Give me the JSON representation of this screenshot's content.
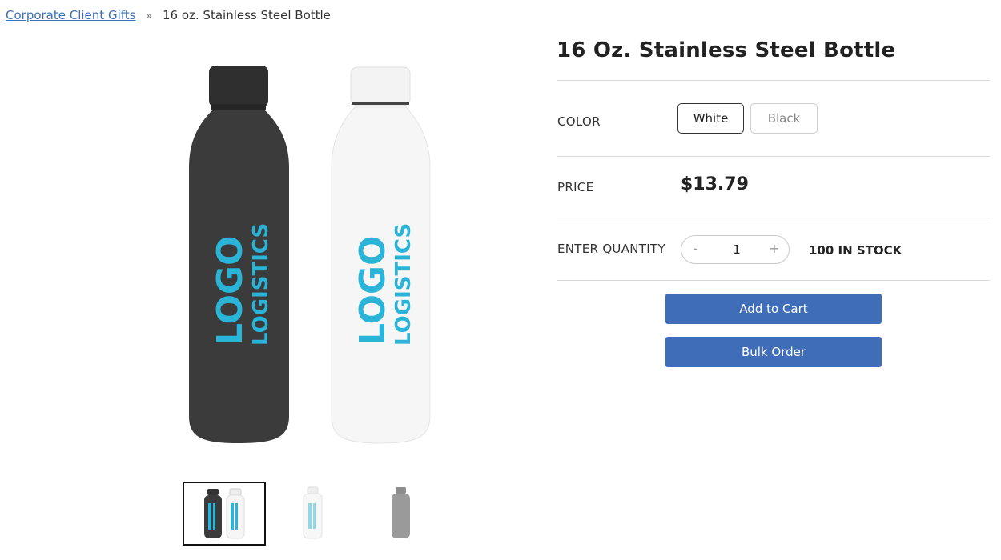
{
  "breadcrumb": {
    "parent": "Corporate Client Gifts",
    "separator": "»",
    "current": "16 oz. Stainless Steel Bottle"
  },
  "product": {
    "title": "16 Oz. Stainless Steel Bottle",
    "logo_text_1": "LOGO",
    "logo_text_2": "LOGISTICS"
  },
  "options": {
    "color_label": "COLOR",
    "colors": [
      {
        "label": "White",
        "selected": true
      },
      {
        "label": "Black",
        "selected": false
      }
    ]
  },
  "price": {
    "label": "PRICE",
    "value": "$13.79"
  },
  "quantity": {
    "label": "ENTER QUANTITY",
    "minus": "-",
    "value": "1",
    "plus": "+",
    "stock": "100 IN STOCK"
  },
  "buttons": {
    "add_to_cart": "Add to Cart",
    "bulk_order": "Bulk Order"
  },
  "colors": {
    "brand_blue": "#3f6db8",
    "logo_cyan": "#29b4d8",
    "bottle_black": "#3b3b3b",
    "bottle_white": "#f6f6f6",
    "bottle_gray": "#9a9a9a"
  },
  "thumbnails": [
    {
      "name": "pair",
      "selected": true
    },
    {
      "name": "white",
      "selected": false
    },
    {
      "name": "gray",
      "selected": false
    }
  ]
}
